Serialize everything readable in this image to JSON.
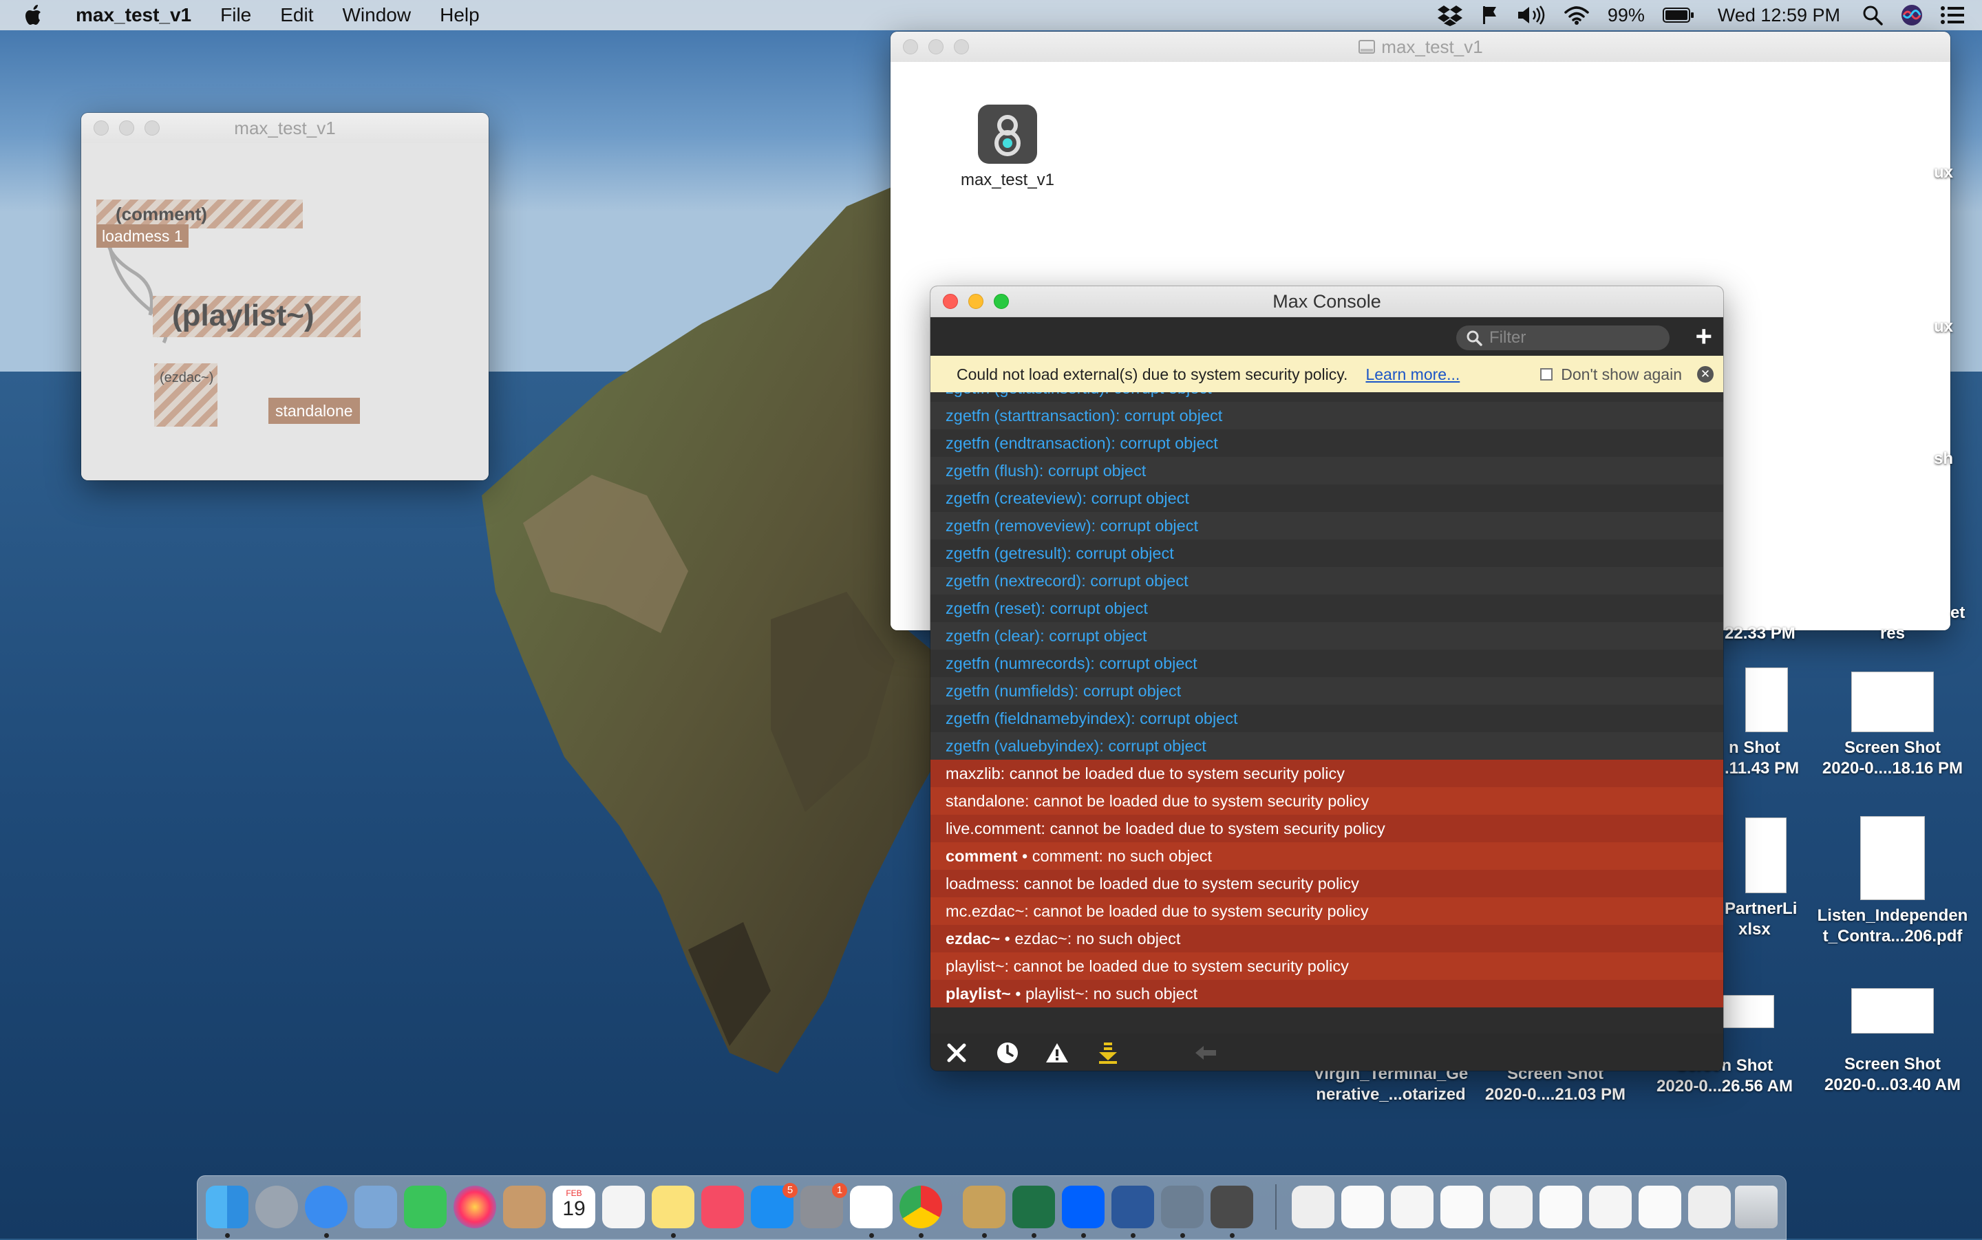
{
  "menubar": {
    "app_name": "max_test_v1",
    "items": [
      "File",
      "Edit",
      "Window",
      "Help"
    ],
    "battery": "99%",
    "clock": "Wed 12:59 PM"
  },
  "patcher": {
    "title": "max_test_v1",
    "comment_label": "(comment)",
    "loadmess_label": "loadmess 1",
    "playlist_label": "(playlist~)",
    "ezdac_label": "(ezdac~)",
    "standalone_label": "standalone"
  },
  "finder": {
    "title": "max_test_v1",
    "file_label": "max_test_v1"
  },
  "console": {
    "title": "Max Console",
    "filter_placeholder": "Filter",
    "banner": {
      "message": "Could not load external(s) due to system security policy.",
      "link": "Learn more...",
      "dont_show": "Don't show again"
    },
    "rows": [
      {
        "type": "blue",
        "text": "zgetfn (getlastinsertid): corrupt object"
      },
      {
        "type": "blue",
        "text": "zgetfn (starttransaction): corrupt object"
      },
      {
        "type": "blue",
        "text": "zgetfn (endtransaction): corrupt object"
      },
      {
        "type": "blue",
        "text": "zgetfn (flush): corrupt object"
      },
      {
        "type": "blue",
        "text": "zgetfn (createview): corrupt object"
      },
      {
        "type": "blue",
        "text": "zgetfn (removeview): corrupt object"
      },
      {
        "type": "blue",
        "text": "zgetfn (getresult): corrupt object"
      },
      {
        "type": "blue",
        "text": "zgetfn (nextrecord): corrupt object"
      },
      {
        "type": "blue",
        "text": "zgetfn (reset): corrupt object"
      },
      {
        "type": "blue",
        "text": "zgetfn (clear): corrupt object"
      },
      {
        "type": "blue",
        "text": "zgetfn (numrecords): corrupt object"
      },
      {
        "type": "blue",
        "text": "zgetfn (numfields): corrupt object"
      },
      {
        "type": "blue",
        "text": "zgetfn (fieldnamebyindex): corrupt object"
      },
      {
        "type": "blue",
        "text": "zgetfn (valuebyindex): corrupt object"
      },
      {
        "type": "err",
        "text": "maxzlib: cannot be loaded due to system security policy"
      },
      {
        "type": "err",
        "text": "standalone: cannot be loaded due to system security policy"
      },
      {
        "type": "err",
        "text": "live.comment: cannot be loaded due to system security policy"
      },
      {
        "type": "err",
        "bold": "comment",
        "text": " • comment: no such object"
      },
      {
        "type": "err",
        "text": "loadmess: cannot be loaded due to system security policy"
      },
      {
        "type": "err",
        "text": "mc.ezdac~: cannot be loaded due to system security policy"
      },
      {
        "type": "err",
        "bold": "ezdac~",
        "text": " • ezdac~: no such object"
      },
      {
        "type": "err",
        "text": "playlist~: cannot be loaded due to system security policy"
      },
      {
        "type": "err",
        "bold": "playlist~",
        "text": " • playlist~: no such object"
      }
    ]
  },
  "desktop_files": [
    {
      "id": "partial_top1",
      "label": "ux"
    },
    {
      "id": "partial_top2",
      "label": "ux"
    },
    {
      "id": "partial_top3",
      "label": "sh"
    },
    {
      "id": "partial_et",
      "label": "et"
    },
    {
      "id": "partial_time",
      "label": "22.33 PM"
    },
    {
      "id": "partial_res",
      "label": "res"
    },
    {
      "id": "shot1",
      "line1": "n Shot",
      "line2": ".11.43 PM"
    },
    {
      "id": "shot2",
      "line1": "Screen Shot",
      "line2": "2020-0....18.16 PM"
    },
    {
      "id": "xlsx",
      "line1": "PartnerLi",
      "line2": "xlsx"
    },
    {
      "id": "pdf",
      "line1": "Listen_Independen",
      "line2": "t_Contra...206.pdf"
    },
    {
      "id": "virgin",
      "line1": "Virgin_Terminal_Ge",
      "line2": "nerative_...otarized"
    },
    {
      "id": "shot3",
      "line1": "Screen Shot",
      "line2": "2020-0....21.03 PM"
    },
    {
      "id": "shot4",
      "line1": "Screen Shot",
      "line2": "2020-0...26.56 AM"
    },
    {
      "id": "shot5",
      "line1": "Screen Shot",
      "line2": "2020-0...03.40 AM"
    }
  ],
  "dock": {
    "calendar_month": "FEB",
    "calendar_day": "19",
    "appstore_badge": "5",
    "prefs_badge": "1"
  },
  "colors": {
    "error_row": "#a33320",
    "info_text": "#38a6f2",
    "banner_bg": "#faf1c2"
  }
}
